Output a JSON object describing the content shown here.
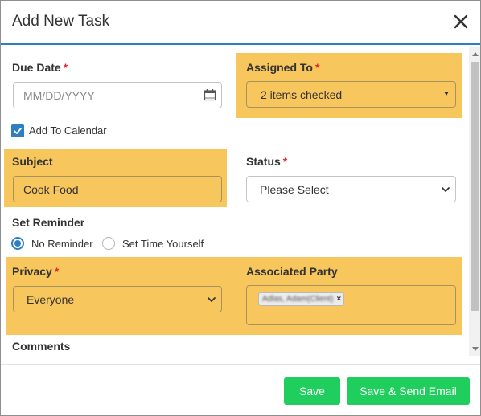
{
  "dialog": {
    "title": "Add New Task",
    "close_icon": "close-icon"
  },
  "form": {
    "due_date": {
      "label": "Due Date",
      "required_mark": "*",
      "placeholder": "MM/DD/YYYY",
      "icon": "calendar-icon"
    },
    "assigned_to": {
      "label": "Assigned To",
      "required_mark": "*",
      "value": "2 items checked"
    },
    "add_to_calendar": {
      "label": "Add To Calendar",
      "checked": true
    },
    "subject": {
      "label": "Subject",
      "value": "Cook Food"
    },
    "status": {
      "label": "Status",
      "required_mark": "*",
      "value": "Please Select"
    },
    "set_reminder": {
      "label": "Set Reminder",
      "options": [
        {
          "label": "No Reminder",
          "selected": true
        },
        {
          "label": "Set Time Yourself",
          "selected": false
        }
      ]
    },
    "privacy": {
      "label": "Privacy",
      "required_mark": "*",
      "value": "Everyone"
    },
    "associated_party": {
      "label": "Associated Party",
      "tag": "Adlas, Adam(Client)",
      "tag_remove": "×"
    },
    "comments": {
      "label": "Comments"
    }
  },
  "footer": {
    "save_label": "Save",
    "save_send_label": "Save & Send Email"
  },
  "colors": {
    "highlight": "#f7c65c",
    "accent": "#2d7fc1",
    "button": "#1fce5c",
    "required": "#e0262d"
  }
}
